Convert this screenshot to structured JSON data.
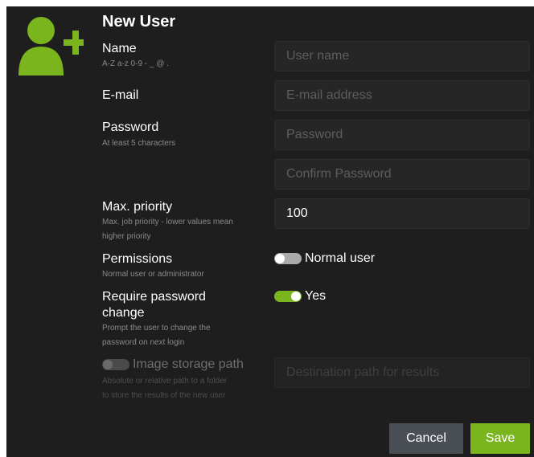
{
  "dialog": {
    "title": "New User"
  },
  "icons": {
    "header": "add-user-icon"
  },
  "colors": {
    "accent": "#7ab51d",
    "background": "#1e1e1e",
    "input_background": "#262626",
    "cancel_button": "#4a4f55"
  },
  "fields": {
    "name": {
      "label": "Name",
      "hint": "A-Z a-z 0-9 - _ @ .",
      "placeholder": "User name"
    },
    "email": {
      "label": "E-mail",
      "placeholder": "E-mail address"
    },
    "password": {
      "label": "Password",
      "hint": "At least 5 characters",
      "placeholder": "Password",
      "confirm_placeholder": "Confirm Password"
    },
    "priority": {
      "label": "Max. priority",
      "hint_line1": "Max. job priority - lower values mean",
      "hint_line2": "higher priority",
      "value": "100"
    },
    "permissions": {
      "label": "Permissions",
      "hint": "Normal user or administrator",
      "toggle_label": "Normal user",
      "toggle_on": false
    },
    "require_change": {
      "label_line1": "Require password",
      "label_line2": "change",
      "hint_line1": "Prompt the user to change the",
      "hint_line2": "password on next login",
      "toggle_label": "Yes",
      "toggle_on": true
    },
    "storage": {
      "label": "Image storage path",
      "hint_line1": "Absolute or relative path to a folder",
      "hint_line2": "to store the results of the new user",
      "placeholder": "Destination path for results",
      "toggle_on": false,
      "disabled": true
    }
  },
  "buttons": {
    "cancel": "Cancel",
    "save": "Save"
  }
}
